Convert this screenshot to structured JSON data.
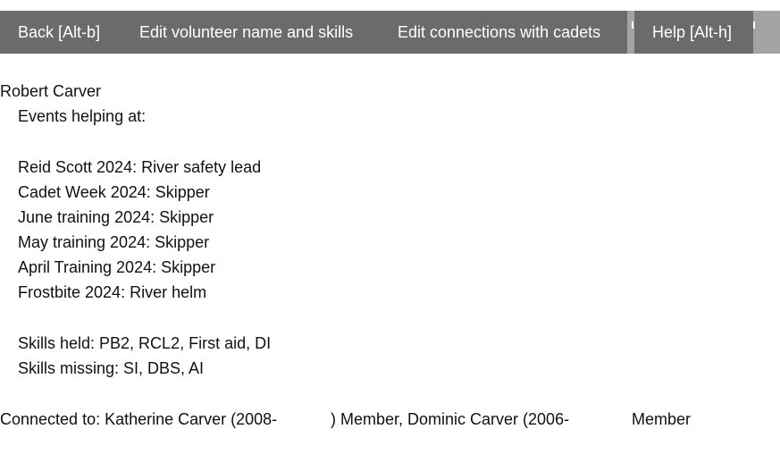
{
  "toolbar": {
    "back_label": "Back [Alt-b]",
    "edit_volunteer_label": "Edit volunteer name and skills",
    "edit_connections_label": "Edit connections with cadets",
    "help_label": "Help [Alt-h]"
  },
  "volunteer": {
    "name": "Robert Carver",
    "events_heading": "Events helping at:",
    "events": [
      "Reid Scott 2024: River safety lead",
      "Cadet Week 2024: Skipper",
      "June training 2024: Skipper",
      "May training 2024: Skipper",
      "April Training 2024: Skipper",
      "Frostbite 2024: River helm"
    ],
    "skills_held": "Skills held: PB2, RCL2, First aid, DI",
    "skills_missing": "Skills missing: SI, DBS, AI",
    "connections_part1": "Connected to: Katherine Carver (2008-",
    "connections_part2": ") Member, Dominic Carver (2006-",
    "connections_part3": "Member"
  }
}
